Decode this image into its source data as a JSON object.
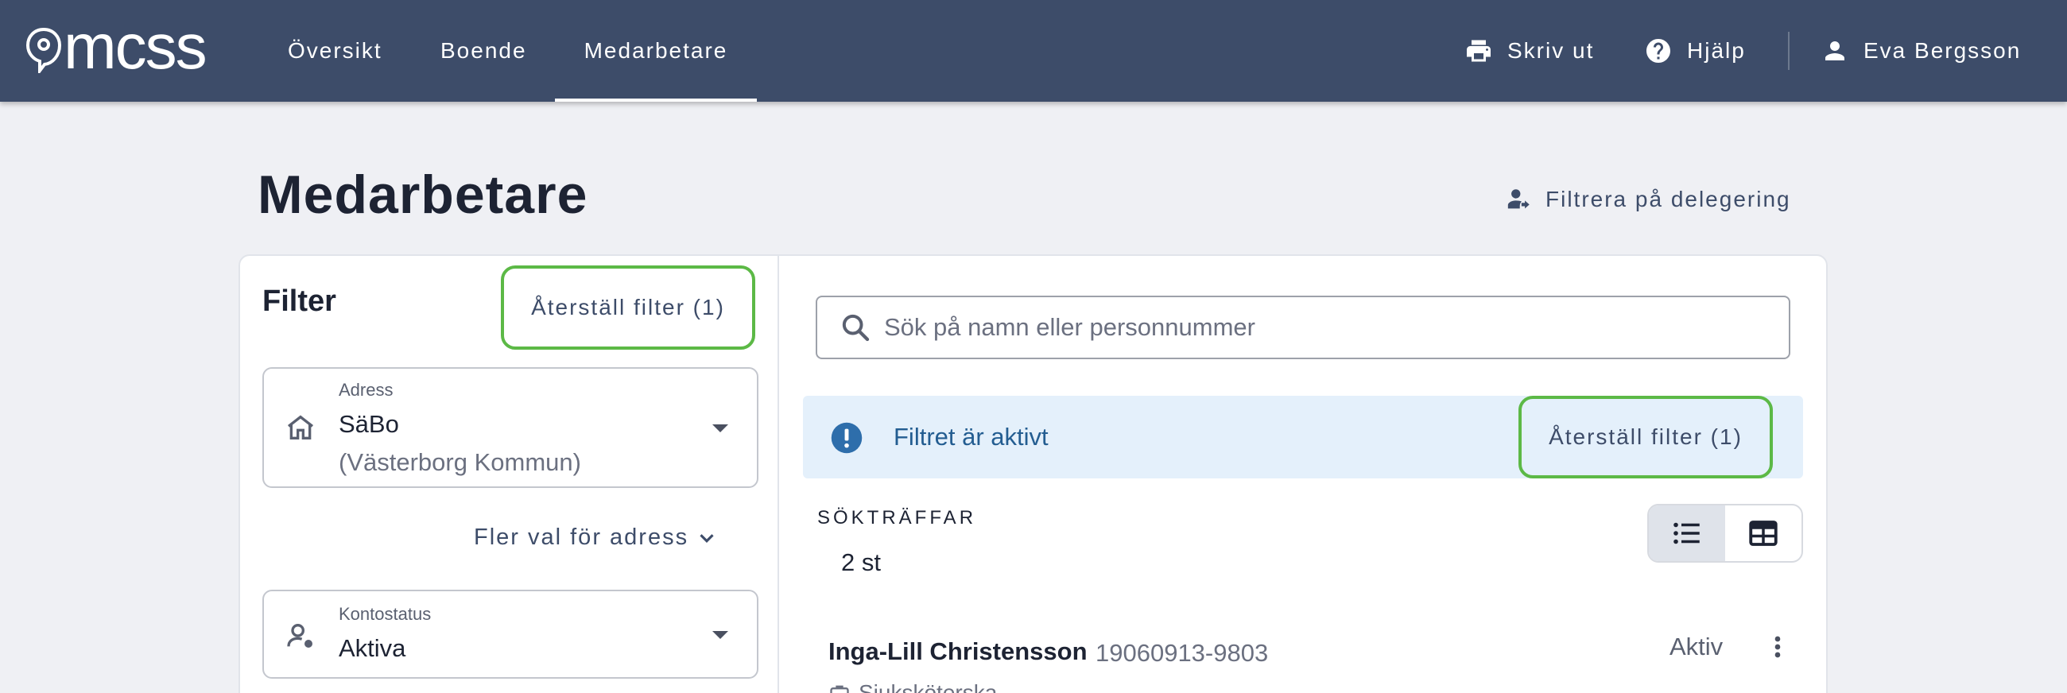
{
  "header": {
    "logo_text": "mcss",
    "nav": [
      {
        "label": "Översikt"
      },
      {
        "label": "Boende"
      },
      {
        "label": "Medarbetare",
        "active": true
      }
    ],
    "actions": {
      "print_label": "Skriv ut",
      "help_label": "Hjälp",
      "user_name": "Eva Bergsson"
    }
  },
  "page": {
    "title": "Medarbetare",
    "delegation_filter_label": "Filtrera på delegering"
  },
  "filter": {
    "title": "Filter",
    "reset_label": "Återställ filter (1)",
    "address": {
      "label": "Adress",
      "value": "SäBo",
      "sub": "(Västerborg Kommun)"
    },
    "more_address_label": "Fler val för adress",
    "account_status": {
      "label": "Kontostatus",
      "value": "Aktiva"
    }
  },
  "results": {
    "search_placeholder": "Sök på namn eller personnummer",
    "alert_text": "Filtret är aktivt",
    "alert_reset_label": "Återställ filter (1)",
    "hits_label": "SÖKTRÄFFAR",
    "hits_count": "2 st",
    "view_mode": "list",
    "rows": [
      {
        "name": "Inga-Lill Christensson",
        "personnummer": "19060913-9803",
        "status": "Aktiv",
        "role": "Sjuksköterska"
      }
    ]
  },
  "colors": {
    "header_bg": "#3d4c69",
    "page_bg": "#eff0f4",
    "highlight_border": "#5cb946",
    "alert_bg": "#e4f0fb",
    "alert_text": "#235d91"
  }
}
